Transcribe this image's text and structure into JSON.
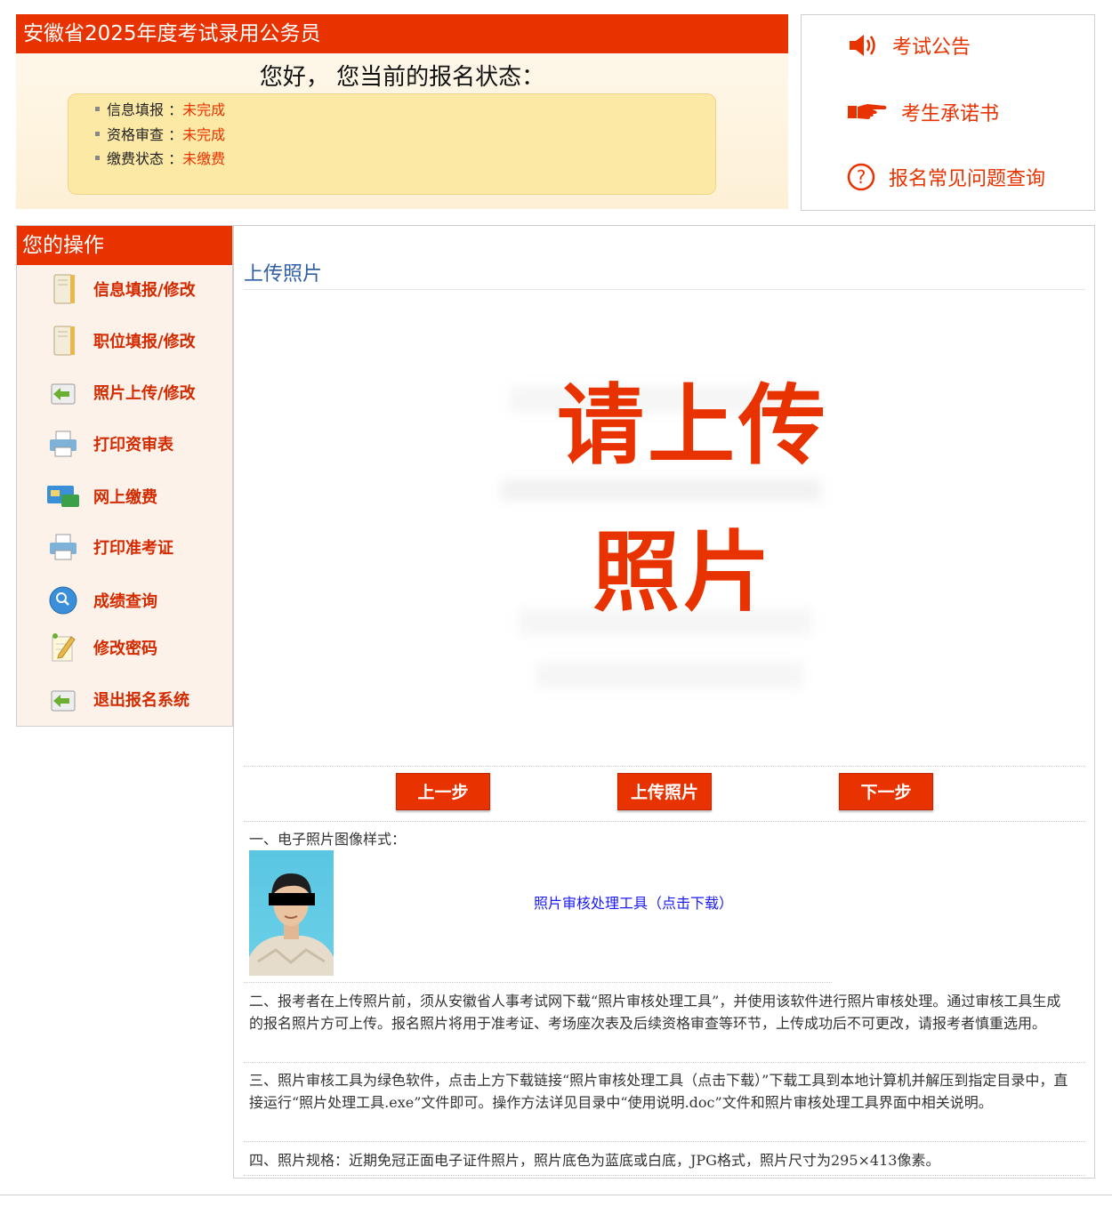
{
  "header": {
    "exam_title": "安徽省2025年度考试录用公务员",
    "greeting": "您好，  您当前的报名状态：",
    "status_items": [
      {
        "label": "信息填报",
        "sep": "：",
        "value": "未完成"
      },
      {
        "label": "资格审查",
        "sep": "：",
        "value": "未完成"
      },
      {
        "label": "缴费状态",
        "sep": "：",
        "value": "未缴费"
      }
    ]
  },
  "quick_links": [
    {
      "label": "考试公告",
      "icon": "speaker-icon"
    },
    {
      "label": "考生承诺书",
      "icon": "pointing-hand-icon"
    },
    {
      "label": "报名常见问题查询",
      "icon": "question-circle-icon"
    }
  ],
  "sidebar": {
    "title": "您的操作",
    "items": [
      {
        "label": "信息填报/修改",
        "icon": "notebook-icon"
      },
      {
        "label": "职位填报/修改",
        "icon": "notebook-icon"
      },
      {
        "label": "照片上传/修改",
        "icon": "upload-tray-icon"
      },
      {
        "label": "打印资审表",
        "icon": "printer-icon"
      },
      {
        "label": "网上缴费",
        "icon": "payment-card-icon"
      },
      {
        "label": "打印准考证",
        "icon": "printer-icon"
      },
      {
        "label": "成绩查询",
        "icon": "magnifier-icon"
      },
      {
        "label": "修改密码",
        "icon": "pencil-note-icon"
      },
      {
        "label": "退出报名系统",
        "icon": "exit-tray-icon"
      }
    ]
  },
  "main": {
    "section_title": "上传照片",
    "placeholder_line1": "请上传",
    "placeholder_line2": "照片",
    "buttons": {
      "prev": "上一步",
      "upload": "上传照片",
      "next": "下一步"
    },
    "notes": {
      "photo_style_title": "一、电子照片图像样式：",
      "tool_link": "照片审核处理工具（点击下载）",
      "note2": "二、报考者在上传照片前，须从安徽省人事考试网下载“照片审核处理工具”，并使用该软件进行照片审核处理。通过审核工具生成的报名照片方可上传。报名照片将用于准考证、考场座次表及后续资格审查等环节，上传成功后不可更改，请报考者慎重选用。",
      "note3": "三、照片审核工具为绿色软件，点击上方下载链接“照片审核处理工具（点击下载）”下载工具到本地计算机并解压到指定目录中，直接运行“照片处理工具.exe”文件即可。操作方法详见目录中“使用说明.doc”文件和照片审核处理工具界面中相关说明。",
      "note4": "四、照片规格：近期免冠正面电子证件照片，照片底色为蓝底或白底，JPG格式，照片尺寸为295×413像素。"
    }
  },
  "colors": {
    "brand_red": "#e83300",
    "link_blue": "#1a1aff",
    "title_blue": "#2f5fa6",
    "status_box": "#fde9a6"
  }
}
